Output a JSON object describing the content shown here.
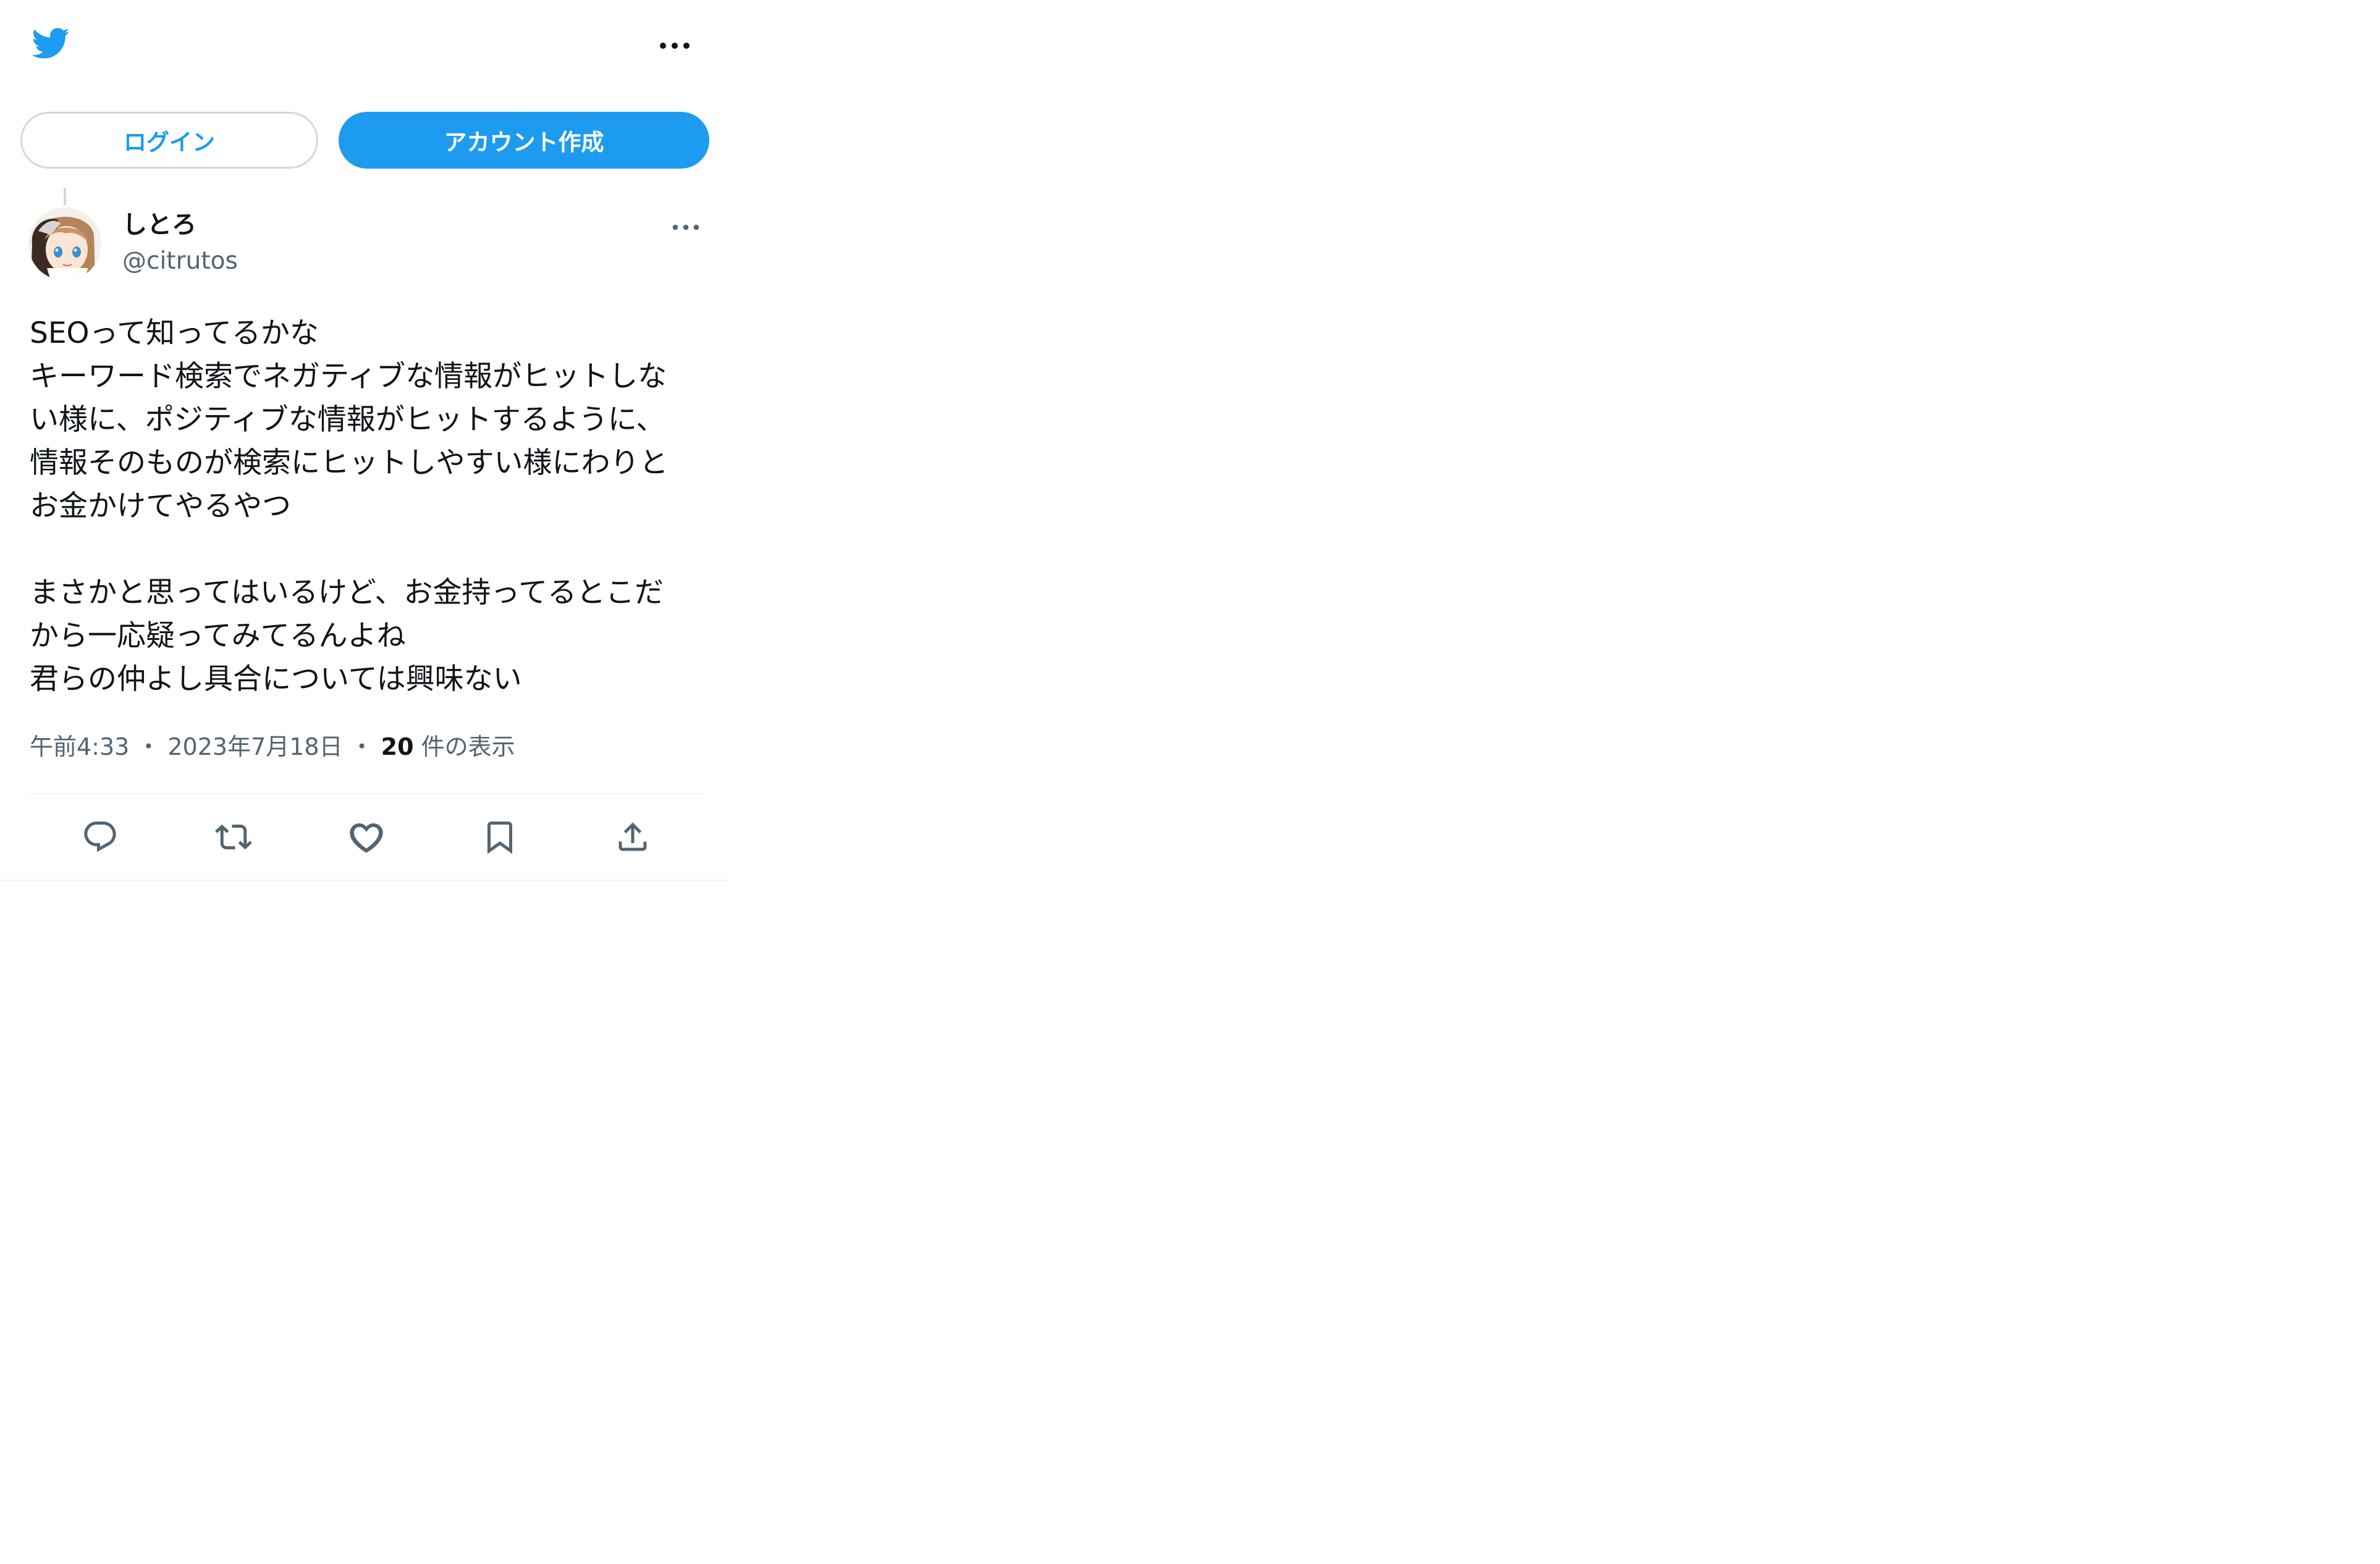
{
  "header": {
    "logo_icon": "twitter-bird-icon",
    "more_icon": "more-horizontal-icon",
    "brand_color": "#1d9bf0"
  },
  "auth": {
    "login_label": "ログイン",
    "signup_label": "アカウント作成"
  },
  "tweet": {
    "author": {
      "name": "しとろ",
      "handle": "@citrutos",
      "avatar_icon": "user-avatar"
    },
    "more_icon": "more-horizontal-icon",
    "text": {
      "lines": [
        "SEOって知ってるかな",
        "キーワード検索でネガティブな情報がヒットしな",
        "い様に、ポジティブな情報がヒットするように、",
        "情報そのものが検索にヒットしやすい様にわりと",
        "お金かけてやるやつ",
        "",
        "まさかと思ってはいるけど、お金持ってるとこだ",
        "から一応疑ってみてるんよね",
        "君らの仲よし具合については興味ない"
      ]
    },
    "meta": {
      "time": "午前4:33",
      "separator": "・",
      "date": "2023年7月18日",
      "separator2": "・",
      "views_count": "20",
      "views_label": "件の表示"
    },
    "actions": [
      {
        "name": "reply",
        "icon": "reply-icon"
      },
      {
        "name": "retweet",
        "icon": "retweet-icon"
      },
      {
        "name": "like",
        "icon": "heart-icon"
      },
      {
        "name": "bookmark",
        "icon": "bookmark-icon"
      },
      {
        "name": "share",
        "icon": "share-icon"
      }
    ]
  }
}
